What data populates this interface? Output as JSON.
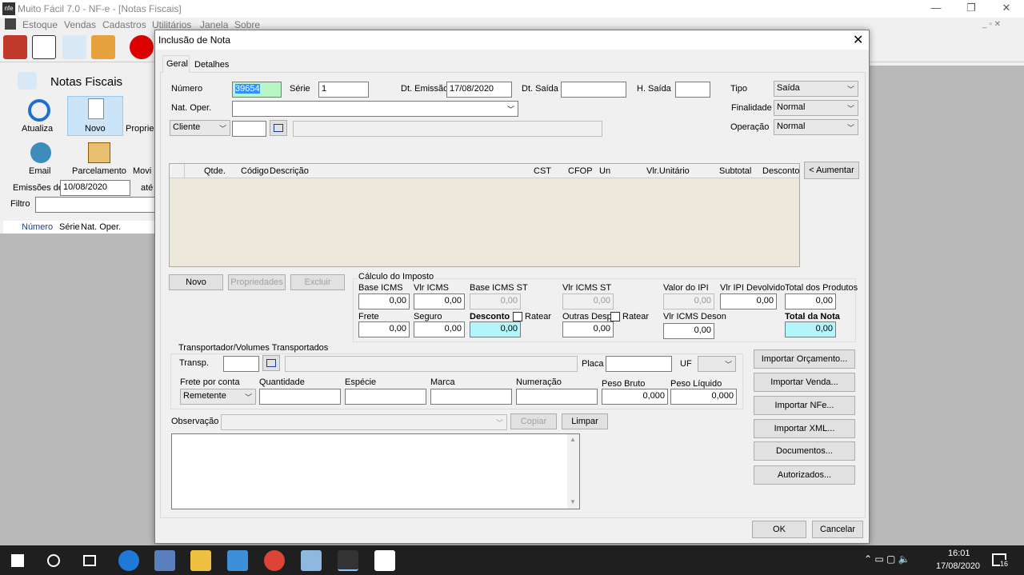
{
  "main": {
    "title": "Muito Fácil 7.0 - NF-e - [Notas Fiscais]",
    "menu": [
      "Estoque",
      "Vendas",
      "Cadastros",
      "Utilitários",
      "Janela",
      "Sobre"
    ],
    "section_title": "Notas Fiscais",
    "buttons": [
      "Atualiza",
      "Novo",
      "Proprie",
      "Email",
      "Parcelamento",
      "Movi"
    ],
    "emissoes_label": "Emissões de",
    "emissoes_from": "10/08/2020",
    "emissoes_ate": "até",
    "filtro_label": "Filtro",
    "list_headers": [
      "Número",
      "Série",
      "Nat. Oper."
    ]
  },
  "dialog": {
    "title": "Inclusão de Nota",
    "tabs": [
      "Geral",
      "Detalhes"
    ],
    "numero_label": "Número",
    "numero_value": "39654",
    "serie_label": "Série",
    "serie_value": "1",
    "dt_emissao_label": "Dt. Emissão",
    "dt_emissao_value": "17/08/2020",
    "dt_saida_label": "Dt. Saída",
    "h_saida_label": "H. Saída",
    "tipo_label": "Tipo",
    "tipo_value": "Saída",
    "finalidade_label": "Finalidade",
    "finalidade_value": "Normal",
    "operacao_label": "Operação",
    "operacao_value": "Normal",
    "nat_oper_label": "Nat. Oper.",
    "cliente_value": "Cliente",
    "grid_headers": [
      "Qtde.",
      "Código",
      "Descrição",
      "CST",
      "CFOP",
      "Un",
      "Vlr.Unitário",
      "Subtotal",
      "Desconto"
    ],
    "aumentar": "< Aumentar",
    "item_buttons": [
      "Novo",
      "Propriedades",
      "Excluir"
    ],
    "calc_title": "Cálculo do Imposto",
    "calc": {
      "base_icms": {
        "label": "Base ICMS",
        "value": "0,00"
      },
      "vlr_icms": {
        "label": "Vlr ICMS",
        "value": "0,00"
      },
      "base_icms_st": {
        "label": "Base ICMS ST",
        "value": "0,00"
      },
      "vlr_icms_st": {
        "label": "Vlr ICMS ST",
        "value": "0,00"
      },
      "valor_ipi": {
        "label": "Valor do IPI",
        "value": "0,00"
      },
      "vlr_ipi_dev": {
        "label": "Vlr IPI Devolvido",
        "value": "0,00"
      },
      "total_produtos": {
        "label": "Total dos Produtos",
        "value": "0,00"
      },
      "frete": {
        "label": "Frete",
        "value": "0,00"
      },
      "seguro": {
        "label": "Seguro",
        "value": "0,00"
      },
      "desconto": {
        "label": "Desconto",
        "value": "0,00"
      },
      "ratear": "Ratear",
      "outras_desp": {
        "label": "Outras Desp",
        "value": "0,00"
      },
      "vlr_icms_deson": {
        "label": "Vlr ICMS Deson",
        "value": "0,00"
      },
      "total_nota": {
        "label": "Total da Nota",
        "value": "0,00"
      }
    },
    "transp_title": "Transportador/Volumes Transportados",
    "transp_label": "Transp.",
    "placa_label": "Placa",
    "uf_label": "UF",
    "frete_conta_label": "Frete por conta",
    "frete_conta_value": "Remetente",
    "quantidade_label": "Quantidade",
    "especie_label": "Espécie",
    "marca_label": "Marca",
    "numeracao_label": "Numeração",
    "peso_bruto_label": "Peso Bruto",
    "peso_bruto_value": "0,000",
    "peso_liquido_label": "Peso Líquido",
    "peso_liquido_value": "0,000",
    "obs_label": "Observação",
    "copiar": "Copiar",
    "limpar": "Limpar",
    "import_buttons": [
      "Importar Orçamento...",
      "Importar Venda...",
      "Importar NFe...",
      "Importar XML...",
      "Documentos...",
      "Autorizados..."
    ],
    "ok": "OK",
    "cancelar": "Cancelar"
  },
  "taskbar": {
    "time": "16:01",
    "date": "17/08/2020",
    "badge": "16"
  }
}
